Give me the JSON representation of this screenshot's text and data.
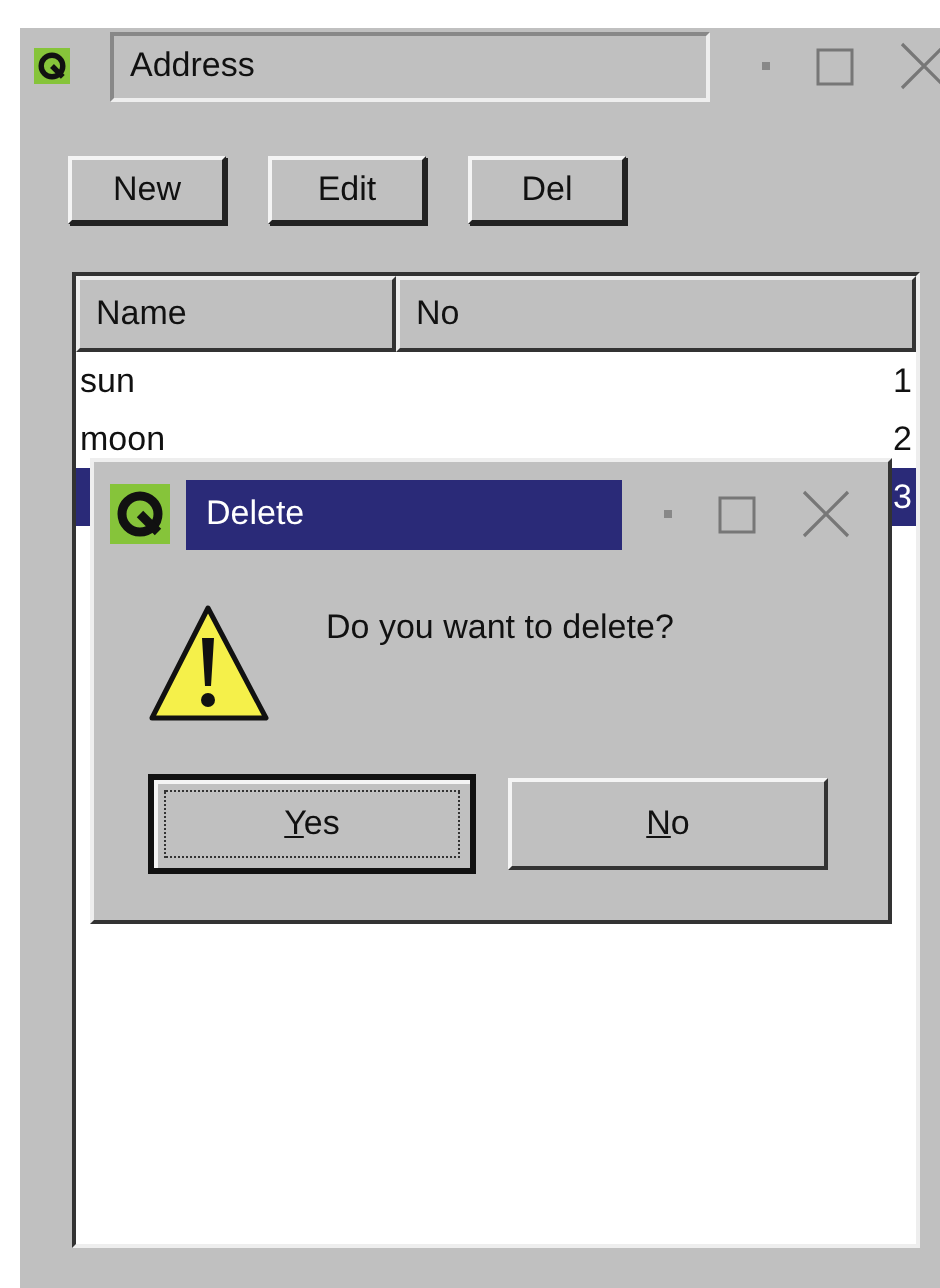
{
  "window": {
    "title": "Address"
  },
  "toolbar": [
    {
      "label": "New"
    },
    {
      "label": "Edit"
    },
    {
      "label": "Del"
    }
  ],
  "table": {
    "columns": [
      "Name",
      "No"
    ],
    "rows": [
      {
        "name": "sun",
        "no": "1",
        "selected": false
      },
      {
        "name": "moon",
        "no": "2",
        "selected": false
      },
      {
        "no": "3",
        "selected": true
      }
    ]
  },
  "dialog": {
    "title": "Delete",
    "message": "Do you want to delete?",
    "buttons": [
      {
        "label": "Yes",
        "default": true,
        "mnemonic": true
      },
      {
        "label": "No",
        "default": false,
        "mnemonic": true
      }
    ]
  }
}
